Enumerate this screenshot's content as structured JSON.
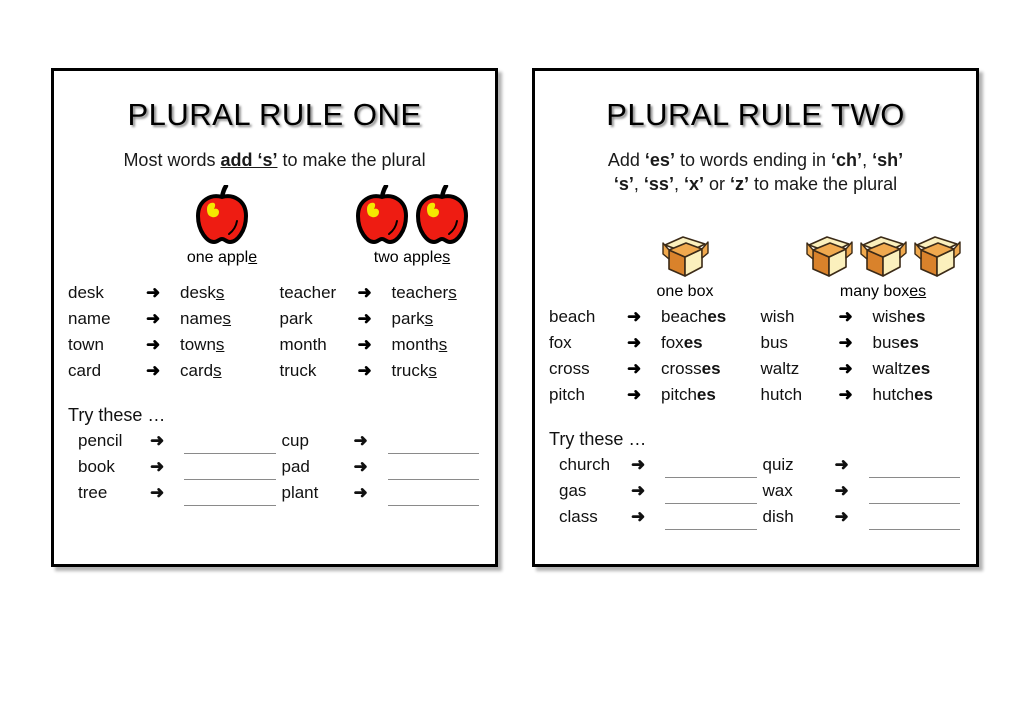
{
  "panels": [
    {
      "title": "PLURAL RULE ONE",
      "subtitle_before": "Most words ",
      "subtitle_mark": "add ‘s’",
      "subtitle_after": " to make the plural",
      "illustration_singular_label_text": "one apple",
      "illustration_singular_label_plain": "one appl",
      "illustration_singular_label_underline": "e",
      "illustration_plural_label_plain": "two apple",
      "illustration_plural_label_underline": "s",
      "icon_singular": "apple-icon",
      "icon_plural": "apple-icon",
      "icon_plural_count": 2,
      "examples_left": [
        {
          "singular": "desk",
          "plural_stem": "desk",
          "plural_suffix": "s"
        },
        {
          "singular": "name",
          "plural_stem": "name",
          "plural_suffix": "s"
        },
        {
          "singular": "town",
          "plural_stem": "town",
          "plural_suffix": "s"
        },
        {
          "singular": "card",
          "plural_stem": "card",
          "plural_suffix": "s"
        }
      ],
      "examples_right": [
        {
          "singular": "teacher",
          "plural_stem": "teacher",
          "plural_suffix": "s"
        },
        {
          "singular": "park",
          "plural_stem": "park",
          "plural_suffix": "s"
        },
        {
          "singular": "month",
          "plural_stem": "month",
          "plural_suffix": "s"
        },
        {
          "singular": "truck",
          "plural_stem": "truck",
          "plural_suffix": "s"
        }
      ],
      "suffix_style": "underline",
      "try_heading": "Try these …",
      "try_left": [
        "pencil",
        "book",
        "tree"
      ],
      "try_right": [
        "cup",
        "pad",
        "plant"
      ]
    },
    {
      "title": "PLURAL RULE TWO",
      "subtitle_line1_pre": "Add ",
      "subtitle_line1_b1": "‘es’",
      "subtitle_line1_mid": " to words ending in ",
      "subtitle_line1_b2": "‘ch’",
      "subtitle_line1_sep": ", ",
      "subtitle_line1_b3": "‘sh’",
      "subtitle_line2_b1": "‘s’",
      "subtitle_line2_sep1": ", ",
      "subtitle_line2_b2": "‘ss’",
      "subtitle_line2_sep2": ", ",
      "subtitle_line2_b3": "‘x’",
      "subtitle_line2_mid": " or ",
      "subtitle_line2_b4": "‘z’",
      "subtitle_line2_post": " to make the plural",
      "illustration_singular_label_plain": "one box",
      "illustration_singular_label_underline": "",
      "illustration_plural_label_plain": "many box",
      "illustration_plural_label_underline": "es",
      "icon_singular": "box-icon",
      "icon_plural": "box-icon",
      "icon_plural_count": 3,
      "examples_left": [
        {
          "singular": "beach",
          "plural_stem": "beach",
          "plural_suffix": "es"
        },
        {
          "singular": "fox",
          "plural_stem": "fox",
          "plural_suffix": "es"
        },
        {
          "singular": "cross",
          "plural_stem": "cross",
          "plural_suffix": "es"
        },
        {
          "singular": "pitch",
          "plural_stem": "pitch",
          "plural_suffix": "es"
        }
      ],
      "examples_right": [
        {
          "singular": "wish",
          "plural_stem": "wish",
          "plural_suffix": "es"
        },
        {
          "singular": "bus",
          "plural_stem": "bus",
          "plural_suffix": "es"
        },
        {
          "singular": "waltz",
          "plural_stem": "waltz",
          "plural_suffix": "es"
        },
        {
          "singular": "hutch",
          "plural_stem": "hutch",
          "plural_suffix": "es"
        }
      ],
      "suffix_style": "bold",
      "try_heading": "Try these …",
      "try_left": [
        "church",
        "gas",
        "class"
      ],
      "try_right": [
        "quiz",
        "wax",
        "dish"
      ]
    }
  ],
  "glyphs": {
    "arrow": "➜"
  },
  "colors": {
    "apple_body": "#ee1c12",
    "apple_outline": "#000000",
    "apple_highlight": "#f5e800",
    "box_front": "#d9822b",
    "box_side": "#f0a94e",
    "box_flap": "#fbf0bd",
    "box_outline": "#3b2a17",
    "border": "#000000",
    "blank_line": "#8a8a8a",
    "text": "#111111"
  }
}
